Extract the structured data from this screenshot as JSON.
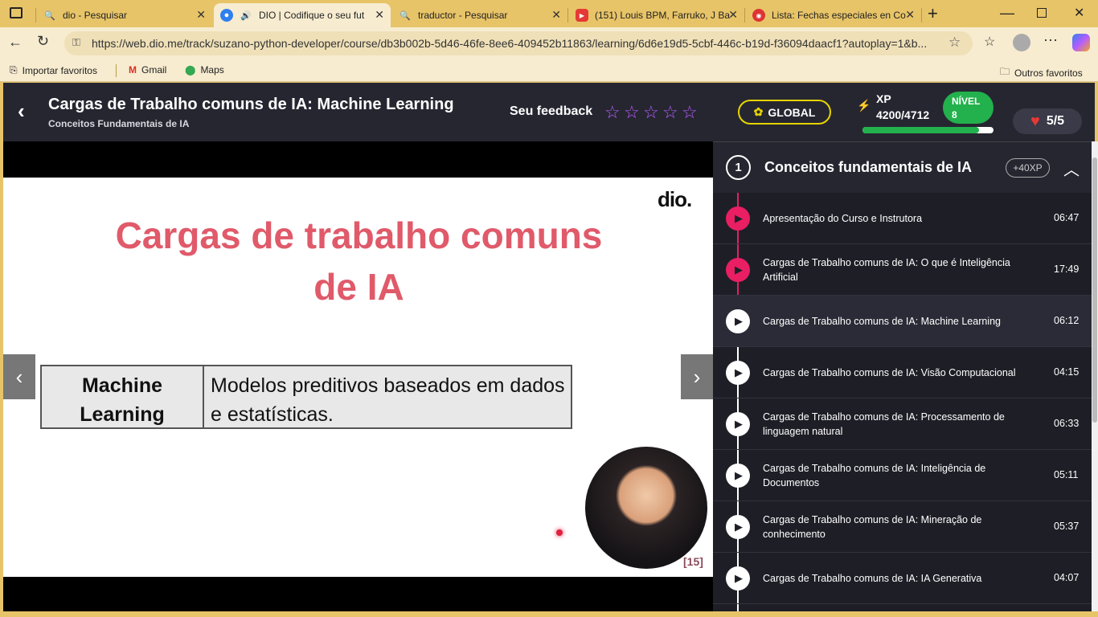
{
  "browser": {
    "tabs": [
      {
        "title": "dio - Pesquisar",
        "icon": "search-icon",
        "active": false
      },
      {
        "title": "DIO | Codifique o seu fut",
        "icon": "dio-icon",
        "active": true
      },
      {
        "title": "traductor - Pesquisar",
        "icon": "search-icon",
        "active": false
      },
      {
        "title": "(151) Louis BPM, Farruko, J Ba",
        "icon": "youtube-icon",
        "active": false
      },
      {
        "title": "Lista: Fechas especiales en Co",
        "icon": "chrome-icon",
        "active": false
      }
    ],
    "url": "https://web.dio.me/track/suzano-python-developer/course/db3b002b-5d46-46fe-8ee6-409452b11863/learning/6d6e19d5-5cbf-446c-b19d-f36094daacf1?autoplay=1&b...",
    "bookmarks": [
      "Importar favoritos",
      "Gmail",
      "Maps"
    ],
    "other_bookmarks": "Outros favoritos"
  },
  "header": {
    "title": "Cargas de Trabalho comuns de IA: Machine Learning",
    "subtitle": "Conceitos Fundamentais de IA",
    "feedback_label": "Seu feedback",
    "rating": 0,
    "rating_max": 5,
    "global_label": "GLOBAL",
    "xp_label": "XP",
    "xp_value": "4200/4712",
    "xp_current": 4200,
    "xp_total": 4712,
    "nivel_label": "NÍVEL",
    "nivel_value": "8",
    "lives": "5/5"
  },
  "slide": {
    "title_line1": "Cargas de trabalho comuns",
    "title_line2": "de IA",
    "logo": "dio.",
    "term": "Machine Learning",
    "definition": "Modelos preditivos baseados em dados e estatísticas.",
    "page": "[15]"
  },
  "sidebar": {
    "module_number": "1",
    "module_title": "Conceitos fundamentais de IA",
    "module_xp": "+40XP",
    "lessons": [
      {
        "title": "Apresentação do Curso e Instrutora",
        "duration": "06:47",
        "status": "done"
      },
      {
        "title": "Cargas de Trabalho comuns de IA: O que é Inteligência Artificial",
        "duration": "17:49",
        "status": "done"
      },
      {
        "title": "Cargas de Trabalho comuns de IA: Machine Learning",
        "duration": "06:12",
        "status": "current"
      },
      {
        "title": "Cargas de Trabalho comuns de IA: Visão Computacional",
        "duration": "04:15",
        "status": "todo"
      },
      {
        "title": "Cargas de Trabalho comuns de IA: Processamento de linguagem natural",
        "duration": "06:33",
        "status": "todo"
      },
      {
        "title": "Cargas de Trabalho comuns de IA: Inteligência de Documentos",
        "duration": "05:11",
        "status": "todo"
      },
      {
        "title": "Cargas de Trabalho comuns de IA: Mineração de conhecimento",
        "duration": "05:37",
        "status": "todo"
      },
      {
        "title": "Cargas de Trabalho comuns de IA: IA Generativa",
        "duration": "04:07",
        "status": "todo"
      }
    ]
  },
  "colors": {
    "accent_pink": "#e91e63",
    "level_green": "#22b14c",
    "global_yellow": "#e6d400",
    "star_purple": "#b65cff",
    "header_bg": "#262631"
  }
}
